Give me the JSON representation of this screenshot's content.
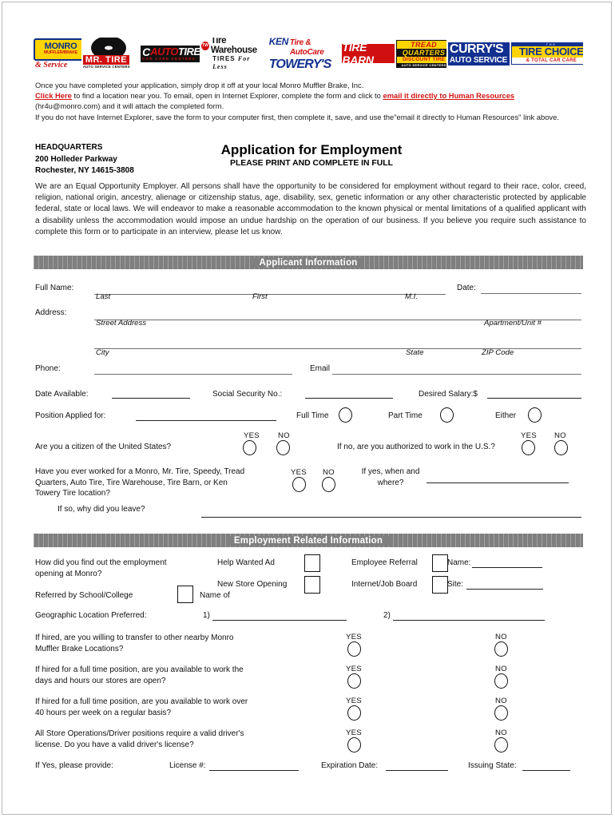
{
  "document": {
    "title": "Application for Employment",
    "subtitle": "PLEASE PRINT AND COMPLETE IN FULL"
  },
  "brand_logos": [
    {
      "name": "monro",
      "line1": "MONRO",
      "line2": "MUFFLER/BRAKE",
      "line3": "& Service"
    },
    {
      "name": "mr-tire",
      "line1": "MR. TIRE",
      "line2": "AUTO SERVICE CENTERS"
    },
    {
      "name": "autotire",
      "line1": "C",
      "line2": "AUTO",
      "line3": "TIRE",
      "line4": "CAR CARE CENTERS"
    },
    {
      "name": "tire-warehouse",
      "line1": "Tire Warehouse",
      "line2": "TIRES",
      "line3": "For Less",
      "badge": "TW"
    },
    {
      "name": "ken-towery",
      "line1": "KEN",
      "line2": "Tire & AutoCare",
      "line3": "TOWERY'S"
    },
    {
      "name": "tire-barn",
      "line1": "TIRE BARN"
    },
    {
      "name": "tread-quarters",
      "line1": "TREAD",
      "line2": "QUARTERS",
      "line3": "DISCOUNT TIRE",
      "line4": "AUTO SERVICE CENTERS"
    },
    {
      "name": "currys",
      "line1": "CURRY'S",
      "line2": "AUTO SERVICE"
    },
    {
      "name": "tire-choice",
      "line0": "THE",
      "line1": "TIRE CHOICE",
      "line2": "& TOTAL CAR CARE"
    }
  ],
  "intro": {
    "line1": "Once you have completed your application, simply drop it off at your local Monro Muffler Brake, Inc.",
    "click_here": "Click Here",
    "line2a": " to find a location near you. To email, open in Internet Explorer, complete the form and click to ",
    "email_link": "email it directly to Human Resources",
    "line3": "(hr4u@monro.com) and it will attach the completed form.",
    "line4": "If you do not have Internet Explorer, save the form to your computer first, then complete it, save, and use the\"email it directly to Human Resources\" link above."
  },
  "headquarters": {
    "label": "HEADQUARTERS",
    "street": "200 Holleder Parkway",
    "citystatezip": "Rochester, NY  14615-3808"
  },
  "eeo_statement": "We are an Equal Opportunity Employer. All persons shall have the opportunity to be considered for employment without regard to their race, color, creed, religion, national origin, ancestry, alienage or citizenship status, age, disability, sex, genetic information or any other characteristic protected by applicable federal, state or local laws. We will endeavor to make a reasonable accommodation to the known physical or mental limitations of a qualified applicant with a disability unless the accommodation would impose an undue hardship on the operation of our business.  If you believe you require such assistance to complete this form or to participate in an interview, please let us know.",
  "applicant_section": {
    "heading": "Applicant Information",
    "full_name_label": "Full Name:",
    "date_label": "Date:",
    "name_sub_last": "Last",
    "name_sub_first": "First",
    "name_sub_mi": "M.I.",
    "address_label": "Address:",
    "address_sub_street": "Street Address",
    "address_sub_apt": "Apartment/Unit #",
    "address_sub_city": "City",
    "address_sub_state": "State",
    "address_sub_zip": "ZIP Code",
    "phone_label": "Phone:",
    "email_label": "Email",
    "date_available_label": "Date Available:",
    "ssn_label": "Social Security No.:",
    "desired_salary_label": "Desired Salary:$",
    "position_label": "Position Applied for:",
    "full_time_label": "Full Time",
    "part_time_label": "Part Time",
    "either_label": "Either",
    "citizen_question": "Are you a citizen of the United States?",
    "authorized_question": "If no, are you authorized to work in the U.S.?",
    "worked_before_question": "Have you ever worked for a Monro, Mr. Tire, Speedy, Tread\nQuarters, Auto Tire, Tire Warehouse, Tire Barn, or Ken\nTowery Tire location?",
    "if_yes_when_where": "If yes, when and\nwhere?",
    "why_leave_question": "If so, why did you leave?",
    "yes": "YES",
    "no": "NO"
  },
  "employment_section": {
    "heading": "Employment Related Information",
    "how_find_question": "How did you find out the employment\nopening at Monro?",
    "help_wanted_ad": "Help Wanted Ad",
    "new_store_opening": "New Store Opening",
    "employee_referral": "Employee Referral",
    "internet_job_board": "Internet/Job Board",
    "name_label": "Name:",
    "site_label": "Site:",
    "referred_by_school": "Referred by School/College",
    "name_of": "Name of",
    "geographic_label": "Geographic Location Preferred:",
    "geo_1": "1)",
    "geo_2": "2)",
    "questions": [
      {
        "text": "If hired, are you willing to transfer to other nearby Monro\nMuffler Brake Locations?",
        "yes": "YES",
        "no": "NO"
      },
      {
        "text": "If hired for a full time position, are you available to work the\ndays and hours our stores are open?",
        "yes": "YES",
        "no": "NO"
      },
      {
        "text": "If hired for a full time position, are you available to work over\n40 hours per week on a regular basis?",
        "yes": "YES",
        "no": "NO"
      },
      {
        "text": "All Store Operations/Driver positions require a valid driver's\nlicense. Do you have a valid driver's license?",
        "yes": "YES",
        "no": "NO"
      }
    ],
    "if_yes_provide": "If Yes, please provide:",
    "license_label": "License #:",
    "expiration_label": "Expiration Date:",
    "issuing_state_label": "Issuing State:"
  },
  "colors": {
    "section_bar": "#807f7f",
    "link_red": "#d41414",
    "brand_blue": "#12308f",
    "brand_red": "#d01010",
    "brand_yellow": "#ffd400"
  }
}
